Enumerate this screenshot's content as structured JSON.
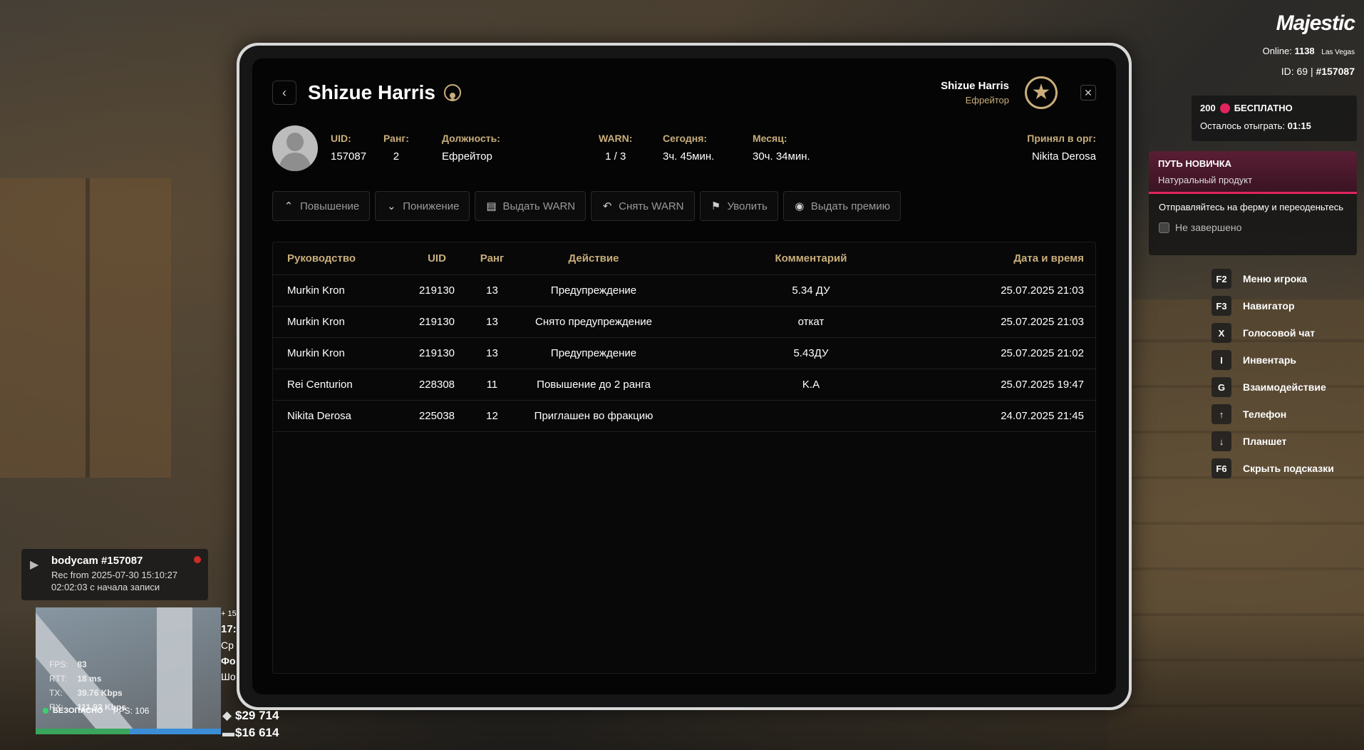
{
  "profile": {
    "name": "Shizue Harris",
    "rank_title": "Ефрейтор",
    "fields": {
      "uid_label": "UID:",
      "uid": "157087",
      "rank_label": "Ранг:",
      "rank": "2",
      "position_label": "Должность:",
      "position": "Ефрейтор",
      "warn_label": "WARN:",
      "warn": "1 / 3",
      "today_label": "Сегодня:",
      "today": "3ч. 45мин.",
      "month_label": "Месяц:",
      "month": "30ч. 34мин.",
      "accepted_label": "Принял в орг:",
      "accepted_by": "Nikita Derosa"
    }
  },
  "actions": [
    {
      "label": "Повышение",
      "icon": "arrow-up-icon"
    },
    {
      "label": "Понижение",
      "icon": "arrow-down-icon"
    },
    {
      "label": "Выдать WARN",
      "icon": "warn-doc-icon"
    },
    {
      "label": "Снять WARN",
      "icon": "undo-icon"
    },
    {
      "label": "Уволить",
      "icon": "fire-user-icon"
    },
    {
      "label": "Выдать премию",
      "icon": "coin-icon"
    }
  ],
  "log_table": {
    "headers": [
      "Руководство",
      "UID",
      "Ранг",
      "Действие",
      "Комментарий",
      "Дата и время"
    ],
    "rows": [
      [
        "Murkin Kron",
        "219130",
        "13",
        "Предупреждение",
        "5.34 ДУ",
        "25.07.2025 21:03"
      ],
      [
        "Murkin Kron",
        "219130",
        "13",
        "Снято предупреждение",
        "откат",
        "25.07.2025 21:03"
      ],
      [
        "Murkin Kron",
        "219130",
        "13",
        "Предупреждение",
        "5.43ДУ",
        "25.07.2025 21:02"
      ],
      [
        "Rei Centurion",
        "228308",
        "11",
        "Повышение до 2 ранга",
        "K.A",
        "25.07.2025 19:47"
      ],
      [
        "Nikita Derosa",
        "225038",
        "12",
        "Приглашен во фракцию",
        "",
        "24.07.2025 21:45"
      ]
    ]
  },
  "hud": {
    "logo": "Majestic",
    "online_label": "Online:",
    "online_count": "1138",
    "server": "Las Vegas",
    "id_line_prefix": "ID: 69 | ",
    "id_line_value": "#157087",
    "promo_amount": "200",
    "promo_label": "БЕСПЛАТНО",
    "promo_remaining_label": "Осталось отыграть:",
    "promo_remaining": "01:15",
    "quest_title": "ПУТЬ НОВИЧКА",
    "quest_subtitle": "Натуральный продукт",
    "quest_text": "Отправляйтесь на ферму и переоденьтесь",
    "quest_status": "Не завершено",
    "hints": [
      {
        "key": "F2",
        "label": "Меню игрока"
      },
      {
        "key": "F3",
        "label": "Навигатор"
      },
      {
        "key": "X",
        "label": "Голосовой чат"
      },
      {
        "key": "I",
        "label": "Инвентарь"
      },
      {
        "key": "G",
        "label": "Взаимодействие"
      },
      {
        "key": "↑",
        "label": "Телефон"
      },
      {
        "key": "↓",
        "label": "Планшет"
      },
      {
        "key": "F6",
        "label": "Скрыть подсказки"
      }
    ],
    "bodycam_title": "bodycam #157087",
    "bodycam_rec": "Rec from 2025-07-30 15:10:27",
    "bodycam_elapsed": "02:02:03 с начала записи",
    "fps": "83",
    "rtt": "18 ms",
    "tx": "39.76 Kbps",
    "rx": "111.93 Kbps",
    "pps": "106",
    "safe_label": "БЕЗОПАСНО",
    "side_partial": [
      "+ 15",
      "17:",
      "Ср",
      "Фо",
      "Шо"
    ],
    "money_1": "$29 714",
    "money_2": "$16 614"
  }
}
